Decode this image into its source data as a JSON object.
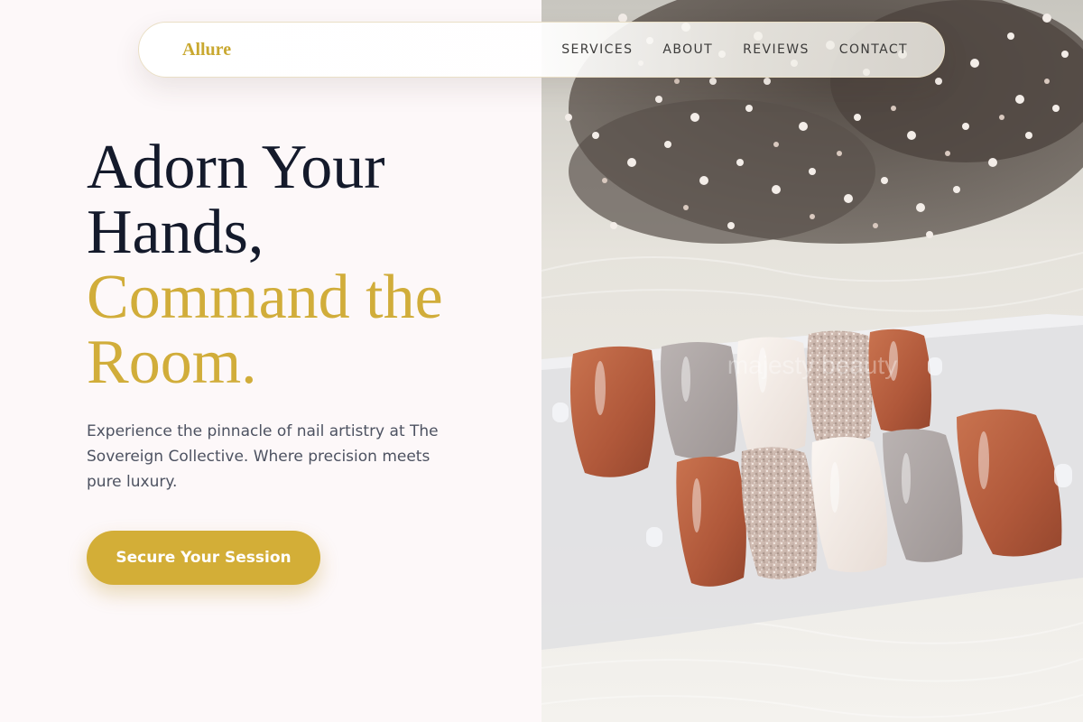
{
  "nav": {
    "brand": "Allure",
    "links": [
      {
        "label": "SERVICES"
      },
      {
        "label": "ABOUT"
      },
      {
        "label": "REVIEWS"
      },
      {
        "label": "CONTACT"
      }
    ]
  },
  "hero": {
    "headline_dark": [
      "Adorn Your",
      "Hands,"
    ],
    "headline_gold": [
      "Command the",
      "Room."
    ],
    "description": "Experience the pinnacle of nail artistry at The Sovereign Collective. Where precision meets pure luxury.",
    "cta_label": "Secure Your Session"
  },
  "photo": {
    "watermark": "majesty beauty"
  },
  "colors": {
    "accent_gold": "#d3ae37",
    "heading_dark": "#141a2b",
    "body_text": "#4d5261",
    "page_background": "#fdf8f9"
  }
}
